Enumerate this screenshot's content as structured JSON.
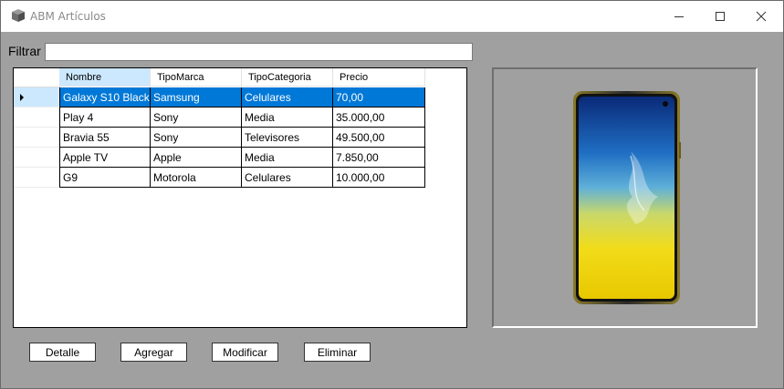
{
  "window": {
    "title": "ABM Artículos",
    "controls": {
      "minimize": "minimize-icon",
      "maximize": "maximize-icon",
      "close": "close-icon"
    }
  },
  "filter": {
    "label": "Filtrar",
    "value": ""
  },
  "grid": {
    "columns": [
      "Nombre",
      "TipoMarca",
      "TipoCategoria",
      "Precio"
    ],
    "rows": [
      [
        "Galaxy S10 Black",
        "Samsung",
        "Celulares",
        "70,00"
      ],
      [
        "Play 4",
        "Sony",
        "Media",
        "35.000,00"
      ],
      [
        "Bravia 55",
        "Sony",
        "Televisores",
        "49.500,00"
      ],
      [
        "Apple TV",
        "Apple",
        "Media",
        "7.850,00"
      ],
      [
        "G9",
        "Motorola",
        "Celulares",
        "10.000,00"
      ]
    ],
    "selected_row": 0,
    "current_row_indicator": "triangle-right-icon"
  },
  "image": {
    "depicts": "smartphone"
  },
  "buttons": {
    "detalle": "Detalle",
    "agregar": "Agregar",
    "modificar": "Modificar",
    "eliminar": "Eliminar"
  },
  "colors": {
    "selection": "#0078d7",
    "header_selected": "#cce8ff",
    "form_bg": "#a0a0a0"
  }
}
